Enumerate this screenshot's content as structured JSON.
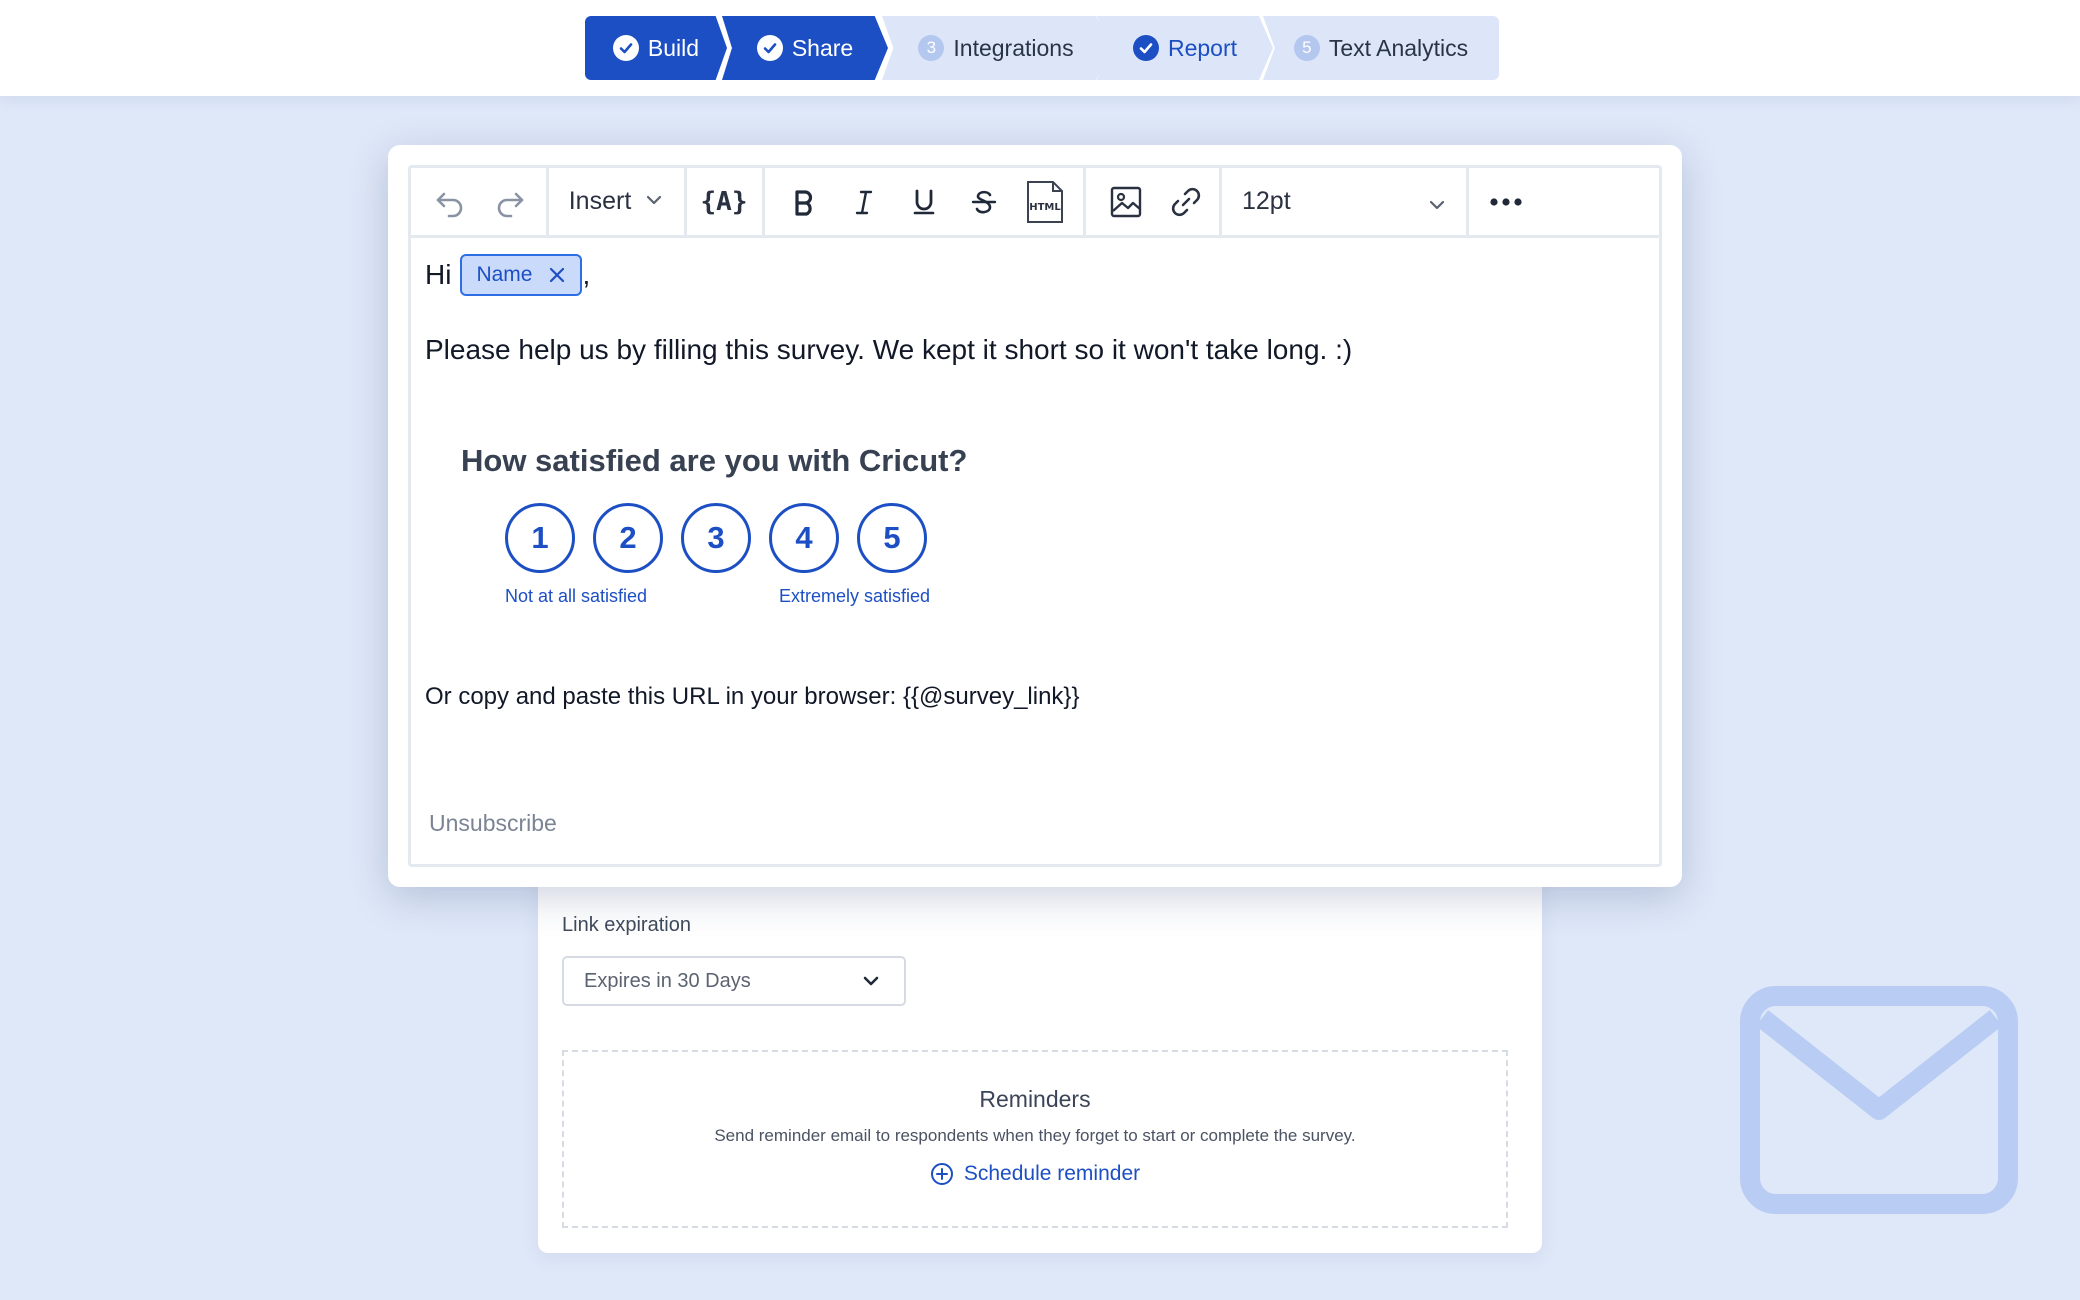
{
  "steps": [
    {
      "label": "Build",
      "state": "done"
    },
    {
      "label": "Share",
      "state": "done"
    },
    {
      "number": "3",
      "label": "Integrations",
      "state": "pending"
    },
    {
      "label": "Report",
      "state": "done-light"
    },
    {
      "number": "5",
      "label": "Text Analytics",
      "state": "pending"
    }
  ],
  "toolbar": {
    "insert_label": "Insert",
    "variable_label": "{A}",
    "html_label": "HTML",
    "font_size": "12pt"
  },
  "editor": {
    "greeting": "Hi",
    "name_chip": "Name",
    "comma": ",",
    "paragraph": "Please help us by filling this survey. We kept it short so it won't take long. :)",
    "question": "How satisfied are you with Cricut?",
    "ratings": [
      "1",
      "2",
      "3",
      "4",
      "5"
    ],
    "low_label": "Not at all satisfied",
    "high_label": "Extremely satisfied",
    "url_line": "Or copy and paste this URL in your browser: {{@survey_link}}",
    "unsubscribe": "Unsubscribe"
  },
  "settings": {
    "link_expiration_label": "Link expiration",
    "link_expiration_value": "Expires in 30 Days",
    "reminders_title": "Reminders",
    "reminders_desc": "Send reminder email to respondents when they forget to start or complete the survey.",
    "schedule_reminder": "Schedule reminder"
  },
  "colors": {
    "primary": "#1d4fc4",
    "background": "#dfe8f8",
    "step_pending": "#dce6f8",
    "chip_bg": "#c9dafa",
    "mail_icon": "#b9ccf3"
  }
}
